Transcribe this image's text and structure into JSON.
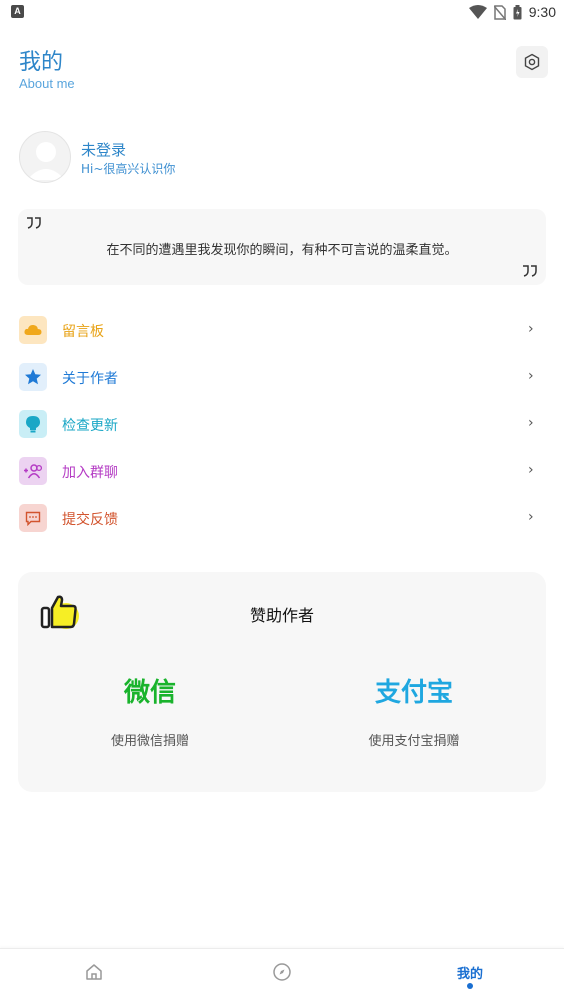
{
  "status_bar": {
    "time": "9:30",
    "left_glyph": "A"
  },
  "header": {
    "title": "我的",
    "subtitle": "About me"
  },
  "profile": {
    "name": "未登录",
    "greeting": "Hi~很高兴认识你"
  },
  "quote": {
    "text": "在不同的遭遇里我发现你的瞬间，有种不可言说的温柔直觉。"
  },
  "menu": [
    {
      "label": "留言板",
      "icon": "cloud-icon",
      "color": "#e8a317",
      "bg": "#fde6c0"
    },
    {
      "label": "关于作者",
      "icon": "star-icon",
      "color": "#1f7ad6",
      "bg": "#e2effb"
    },
    {
      "label": "检查更新",
      "icon": "bulb-icon",
      "color": "#1aa7c6",
      "bg": "#c9eef6"
    },
    {
      "label": "加入群聊",
      "icon": "group-add-icon",
      "color": "#b43bc4",
      "bg": "#ecd3f1"
    },
    {
      "label": "提交反馈",
      "icon": "feedback-icon",
      "color": "#d2542e",
      "bg": "#f7d5d1"
    }
  ],
  "donate": {
    "title": "赞助作者",
    "wechat": {
      "label": "微信",
      "caption": "使用微信捐赠",
      "color": "#19b32c"
    },
    "alipay": {
      "label": "支付宝",
      "caption": "使用支付宝捐赠",
      "color": "#1fa7e0"
    }
  },
  "bottom_nav": {
    "active_label": "我的",
    "accent": "#1a6fd1"
  }
}
